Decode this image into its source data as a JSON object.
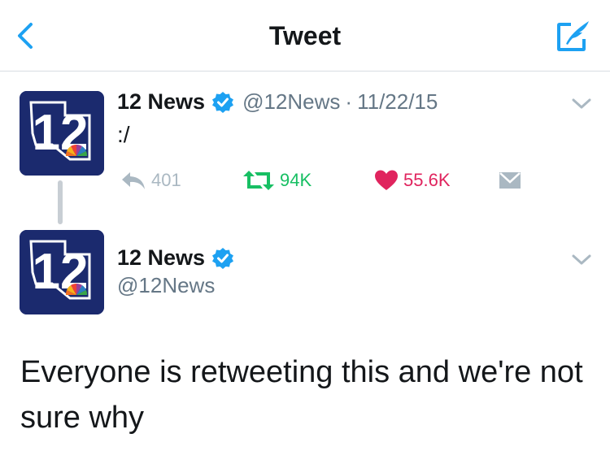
{
  "header": {
    "title": "Tweet"
  },
  "quoted_tweet": {
    "author_name": "12 News",
    "handle": "@12News",
    "date": "11/22/15",
    "text": ":/",
    "reply_count": "401",
    "retweet_count": "94K",
    "like_count": "55.6K"
  },
  "main_tweet": {
    "author_name": "12 News",
    "handle": "@12News",
    "text": "Everyone is retweeting this and we're not sure why"
  },
  "logo": {
    "number": "12"
  },
  "colors": {
    "accent": "#1da1f2",
    "retweet": "#17bf63",
    "like": "#e0245e",
    "muted": "#aab8c2",
    "avatar_bg": "#1b2a6e"
  },
  "icons": {
    "back": "chevron-left-icon",
    "compose": "compose-icon",
    "verified": "verified-badge-icon",
    "reply": "reply-icon",
    "retweet": "retweet-icon",
    "like": "heart-icon",
    "dm": "envelope-icon",
    "more": "chevron-down-icon"
  }
}
